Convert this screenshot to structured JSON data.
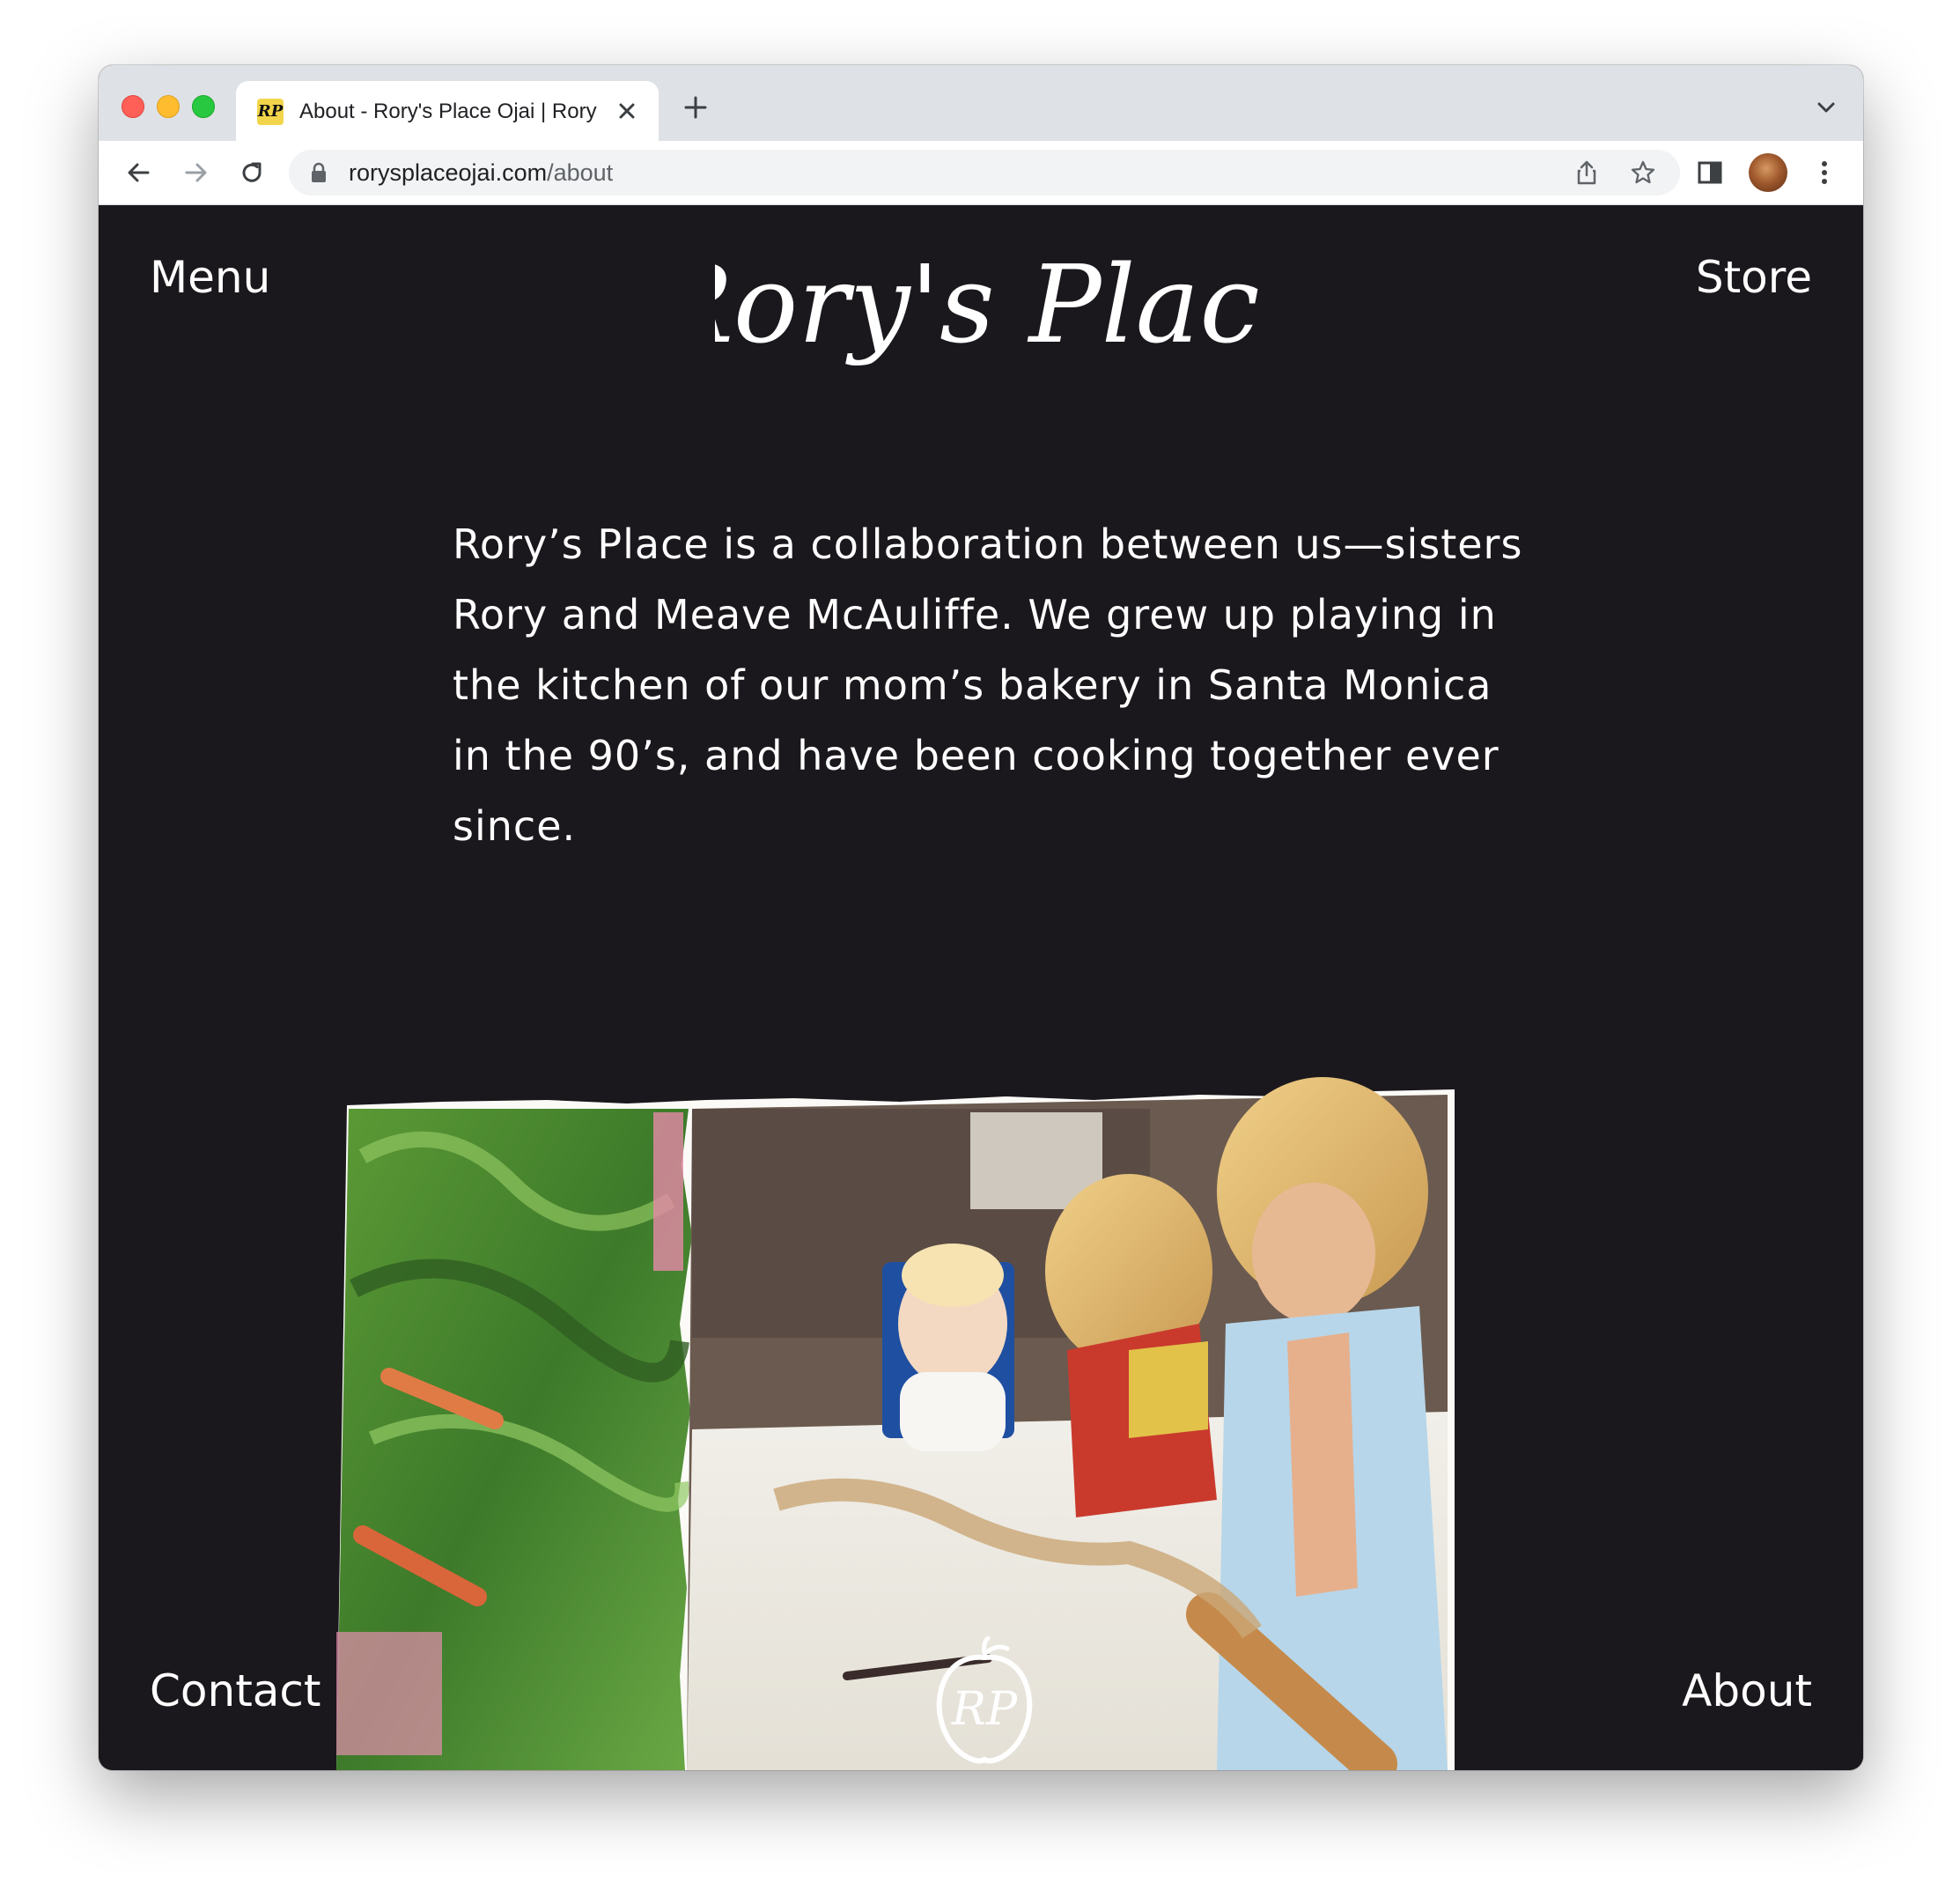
{
  "browser": {
    "tab_title": "About - Rory's Place Ojai | Rory",
    "favicon_text": "RP",
    "url_host": "rorysplaceojai.com",
    "url_path": "/about"
  },
  "site": {
    "nav_left": "Menu",
    "nav_right": "Store",
    "logo_text": "Rory's Place",
    "intro": "Rory’s Place is a collaboration between us—sisters Rory and Meave McAuliffe. We grew up playing in the kitchen of our mom’s bakery in Santa Monica in the 90’s, and have been cooking together ever since.",
    "footer_left": "Contact",
    "footer_right": "About",
    "badge_text": "RP"
  },
  "colors": {
    "page_background": "#1b181d",
    "text": "#ffffff",
    "favicon_background": "#f3d54b"
  },
  "icons": [
    "close-icon",
    "new-tab-icon",
    "tab-menu-chevron-icon",
    "back-arrow-icon",
    "forward-arrow-icon",
    "reload-icon",
    "lock-icon",
    "share-icon",
    "bookmark-star-icon",
    "side-panel-icon",
    "profile-avatar",
    "kebab-menu-icon"
  ]
}
